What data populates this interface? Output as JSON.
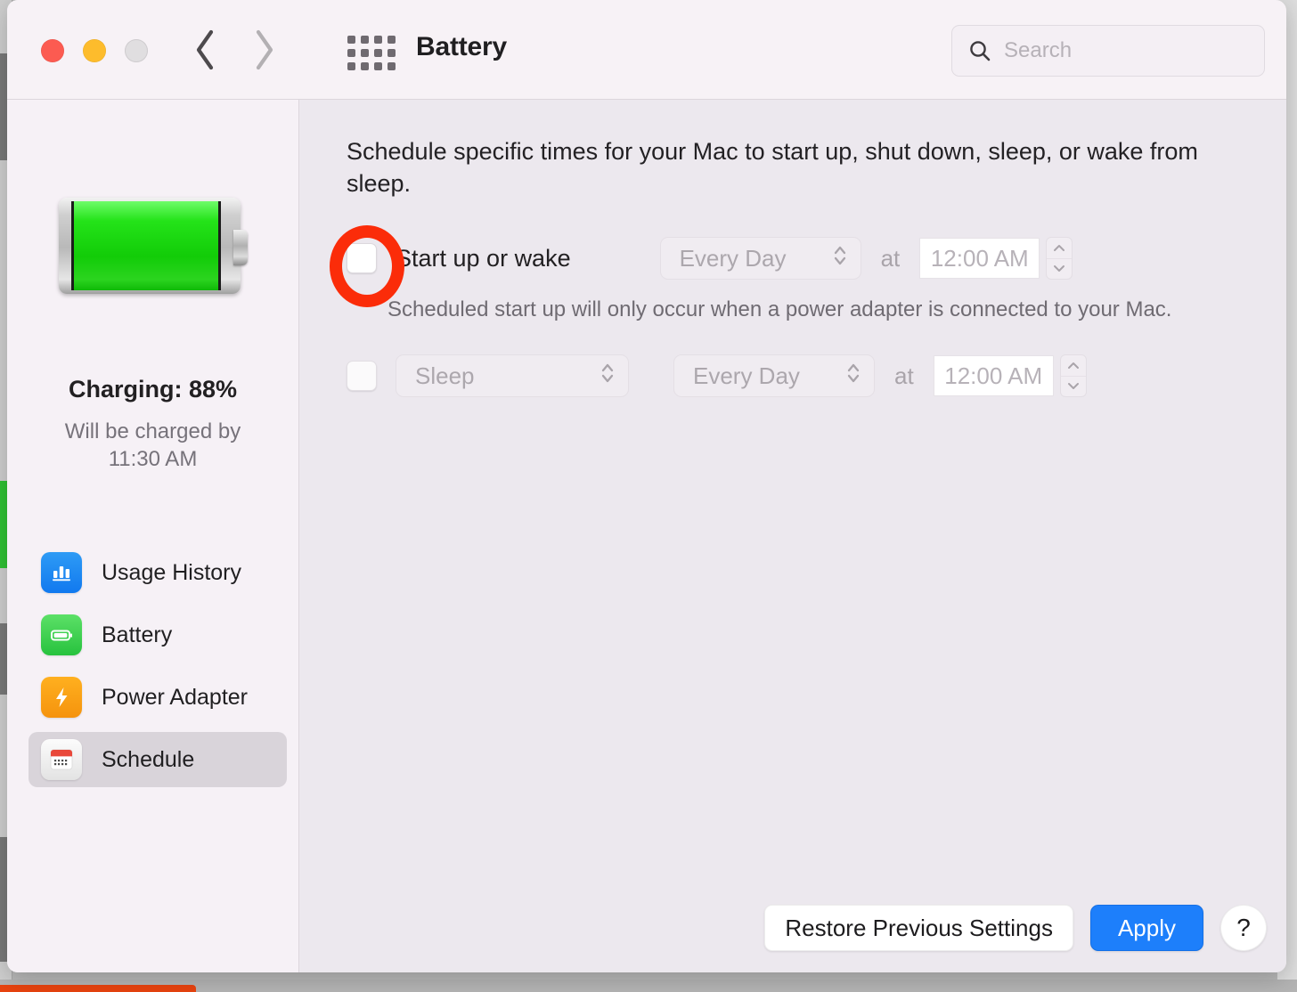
{
  "window": {
    "title": "Battery",
    "traffic_lights": [
      "close",
      "minimize",
      "zoom-disabled"
    ],
    "apps_grid_icon": "apps-grid-icon"
  },
  "search": {
    "placeholder": "Search",
    "icon": "search-icon",
    "value": ""
  },
  "sidebar": {
    "battery_icon": "battery-full-icon",
    "charge_status": "Charging: 88%",
    "charge_detail": "Will be charged by\n11:30 AM",
    "charge_detail_line1": "Will be charged by",
    "charge_detail_line2": "11:30 AM",
    "items": [
      {
        "label": "Usage History",
        "icon": "usage-history-icon",
        "selected": false
      },
      {
        "label": "Battery",
        "icon": "battery-icon",
        "selected": false
      },
      {
        "label": "Power Adapter",
        "icon": "power-adapter-icon",
        "selected": false
      },
      {
        "label": "Schedule",
        "icon": "calendar-icon",
        "selected": true
      }
    ]
  },
  "main": {
    "description": "Schedule specific times for your Mac to start up, shut down, sleep, or wake from sleep.",
    "startup_row": {
      "checkbox_checked": false,
      "label": "Start up or wake",
      "frequency": "Every Day",
      "at_label": "at",
      "time": "12:00 AM",
      "disabled": true
    },
    "note": "Scheduled start up will only occur when a power adapter is connected to your Mac.",
    "sleep_row": {
      "checkbox_checked": false,
      "action": "Sleep",
      "frequency": "Every Day",
      "at_label": "at",
      "time": "12:00 AM",
      "disabled": true
    }
  },
  "footer": {
    "restore_label": "Restore Previous Settings",
    "apply_label": "Apply",
    "help_label": "?"
  },
  "annotation": {
    "type": "highlight-ring",
    "target": "startup-or-wake-checkbox",
    "color": "#fb2c09"
  },
  "colors": {
    "accent_blue": "#1d7ffb",
    "sidebar_bg": "#f6f1f6",
    "content_bg": "#ece8ee",
    "toolbar_bg": "#f7f2f6",
    "battery_green": "#24e319",
    "annotation_red": "#fb2c09"
  }
}
